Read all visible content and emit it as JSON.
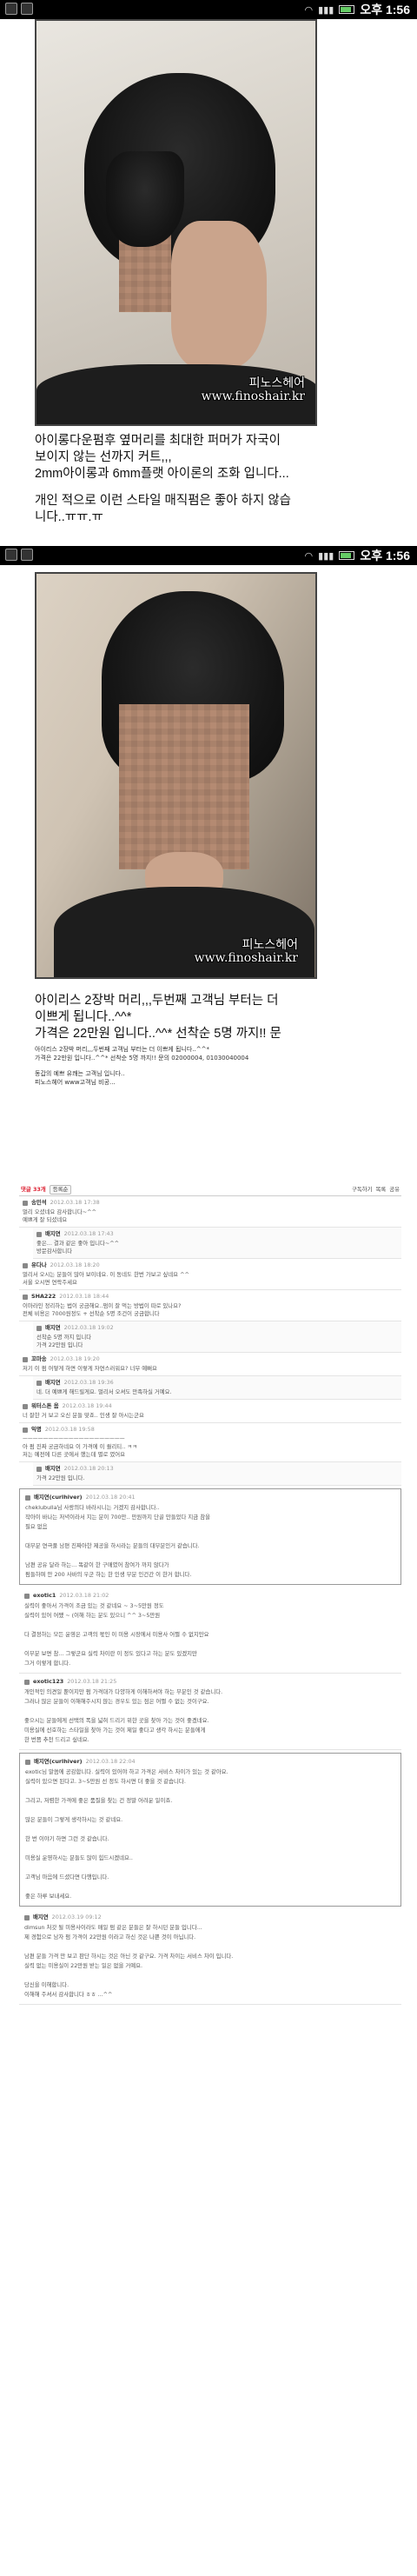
{
  "status_bar_1": {
    "time": "오후 1:56"
  },
  "status_bar_2": {
    "time": "오후 1:56"
  },
  "photo1": {
    "watermark_line1": "피노스헤어",
    "watermark_line2": "www.finoshair.kr"
  },
  "caption1": {
    "line1": "아이롱다운펌후 옆머리를 최대한 퍼머가 자국이",
    "line2": "보이지 않는 선까지 커트,,,",
    "line3": "2mm아이롱과 6mm플랫 아이론의 조화 입니다...",
    "line4": "개인 적으로 이런 스타일 매직펌은 좋아 하지 않습",
    "line5": "니다..ㅠㅠ.ㅠ"
  },
  "photo2": {
    "watermark_line1": "피노스헤어",
    "watermark_line2": "www.finoshair.kr"
  },
  "caption2": {
    "line1": "아이리스 2장박 머리,,,두번째 고객님 부터는 더",
    "line2": "이쁘게 됩니다..^^*",
    "line3": "가격은 22만원 입니다..^^* 선착순 5명 까지!! 문",
    "small1": "아이리스 2장박 머리,,,두번째 고객님 부터는 더 이쁘게 됩니다..^^*",
    "small2": "가격은 22만원 입니다..^^* 선착순 5명 까지!! 문의 02000004, 01030040004",
    "small3": "동갑의 예쁘 유쾌는 고객님 입니다..",
    "small4": "피노스헤어 www고객님 비공..."
  },
  "forum": {
    "toolbar_left": "댓글 33개",
    "toolbar_sort": "등록순",
    "toolbar_right1": "구독하기",
    "toolbar_right2": "목록",
    "toolbar_right3": "공유",
    "comments": [
      {
        "name": "송민석",
        "date": "2012.03.18 17:38",
        "body": "멀리 오셨네요 감사합니다~^^\n예쁘게 잘 되셨네요",
        "reply": false
      },
      {
        "name": "배지연",
        "date": "2012.03.18 17:43",
        "body": "좋은... 결과 같은 좋아 입니다~^^\n방문감사합니다",
        "reply": true
      },
      {
        "name": "유다나",
        "date": "2012.03.18 18:20",
        "body": "멀리서 오시는 분들이 많아 보이네요. 이 동네도 한번 가보고 싶네요 ^^\n서울 오시면 연락주세요",
        "reply": false
      },
      {
        "name": "SHA222",
        "date": "2012.03.18 18:44",
        "body": "이마라인 정리하는 법이 궁금해요..펌이 잘 먹는 방법이 따로 있나요?\n전체 비용은 7000원정도 + 선착순 5명 조건이 궁금합니다",
        "reply": false
      },
      {
        "name": "배지연",
        "date": "2012.03.18 19:02",
        "body": "선착순 5명 까지 입니다\n가격 22만원 입니다",
        "reply": true
      },
      {
        "name": "꼬마송",
        "date": "2012.03.18 19:20",
        "body": "저기 이 펌 어떻게 하면 이렇게 자연스러워요? 너무 예뻐요",
        "reply": false
      },
      {
        "name": "배지연",
        "date": "2012.03.18 19:36",
        "body": "네. 더 예쁘게 해드릴게요. 멀리서 오셔도 만족하실 거예요.",
        "reply": true
      },
      {
        "name": "워터스톤 옴",
        "date": "2012.03.18 19:44",
        "body": "너 잘한 거 보고 오신 분들 맞죠.. 인생 잘 아시는군요\n",
        "reply": false
      },
      {
        "name": "익명",
        "date": "2012.03.18 19:58",
        "body": "ㅡㅡㅡㅡㅡㅡㅡㅡㅡㅡㅡㅡㅡㅡㅡㅡㅡㅡㅡㅡ\n아 펌 진짜 궁금하네요 이 가격에 이 퀄리티.. ㅋㅋ\n저는 예전에 다른 곳에서 했는데 별로 였어요",
        "reply": false
      },
      {
        "name": "배지연",
        "date": "2012.03.18 20:13",
        "body": "가격 22만원 입니다.",
        "reply": true
      }
    ],
    "thread": [
      {
        "name": "배지연(curlhiver)",
        "date": "2012.03.18 20:41",
        "body": "cheklubulla님 사랑의다 바라시니는 거겠지 감사합니다..\n작아이 바나는 저녁이라서 지는 분이 700만.. 만원까지 단골 만들었다 지금 참을\n필요 없음\n\n대부분 연극풀 남편 진짜아한 제공을 하시라는 분들의 대부분인거 같습니다.\n\n남편 공유 달라 하는... 똑같이 한 구매였어 참여가 까지 않다가\n펌들하며 안 200 사바의 우군 하는 한 인생 부분 인건간 이 한거 합니다.",
        "boxed": true
      },
      {
        "name": "exotic1",
        "date": "2012.03.18 21:02",
        "body": "실력이 좋아서 가격이 조금 있는 것 같네요 ~ 3~5만원 정도\n실력이 있어 어쨌 ~ (이해 하는 분도 있으니 ^^ 3~5만원\n\n다 결정하는 모든 운영은 고객의 몫인 이 미용 시장에서 미용사 어쩔 수 없지만요\n\n이부분 보면 참... 그렇군요 실력 차이란 이 정도 있다고 하는 분도 있겠지만\n그거 이렇게 합니다.",
        "boxed": false
      },
      {
        "name": "exotic123",
        "date": "2012.03.18 21:25",
        "body": "개인적인 의견일 뿐이지만 펌 가격대가 다양하게 이해하셔야 하는 부분인 것 같습니다.\n그러나 많은 분들이 이해해주시지 않는 경우도 있는 점은 어쩔 수 없는 것이구요.\n\n좋으시는 분들에게 선택의 폭을 넓혀 드리기 위한 곳을 찾아 가는 것이 좋겠네요.\n미용실에 선호하는 스타일을 찾아 가는 것이 제일 좋다고 생각 하시는 분들에게\n한 번쯤 추천 드리고 싶네요.",
        "boxed": false
      },
      {
        "name": "배지연(curlhiver)",
        "date": "2012.03.18 22:04",
        "body": "exotic님 말씀에 공감합니다. 실력이 있어야 하고 가격은 서비스 차이가 있는 것 같아요.\n실력이 있으면 된다고. 3~5만원 선 정도 하시면 더 좋을 것 같습니다.\n\n그리고, 저렴한 가격에 좋은 품질을 찾는 건 정말 어려운 일이죠.\n\n많은 분들이 그렇게 생각하시는 것 같네요.\n\n한 번 이야기 하면 그런 것 같습니다.\n\n미용실 운영하시는 분들도 많이 힘드시겠네요..\n\n고객님 마음에 드셨다면 다행입니다.\n\n좋은 하루 보내세요.",
        "boxed": true
      },
      {
        "name": "배지연",
        "date": "2012.03.19 09:12",
        "body": "dimsun 처갓 될 미용사이라도 매일 펌 같은 분들은 잘 하시던 분들 입니다...\n제 경험으로 남자 펌 가격이 22만원 이라고 하신 것은 나쁜 것이 아닙니다.\n\n남편 분들 가격 만 보고 판단 하시는 것은 아닌 것 같구요. 가격 차이는 서비스 차이 입니다.\n실력 없는 미용실이 22만원 받는 일은 없을 거예요.\n\n당신을 이해합니다.\n이해해 주셔서 감사합니다 ㅎㅎ ...^^",
        "boxed": false
      }
    ]
  }
}
